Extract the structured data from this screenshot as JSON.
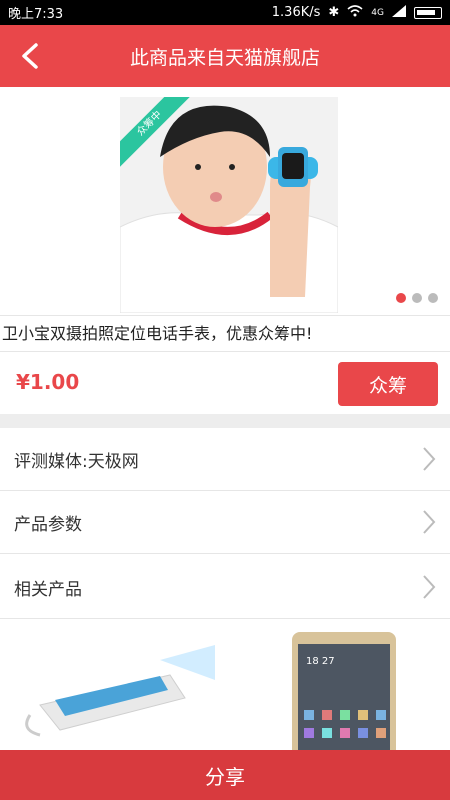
{
  "status_bar": {
    "time": "晚上7:33",
    "speed": "1.36K/s",
    "network": "4G"
  },
  "header": {
    "title": "此商品来自天猫旗舰店",
    "back_icon": "back-arrow-icon"
  },
  "banner": {
    "ribbon_text": "众筹中",
    "carousel_pages": 3,
    "active_page": 1
  },
  "product": {
    "title": "卫小宝双摄拍照定位电话手表，优惠众筹中!",
    "price": "¥1.00",
    "action_label": "众筹"
  },
  "list_items": [
    {
      "label": "评测媒体:天极网"
    },
    {
      "label": "产品参数"
    },
    {
      "label": "相关产品"
    }
  ],
  "related_products": {
    "phone_time": "18 27"
  },
  "footer": {
    "share_label": "分享"
  },
  "colors": {
    "accent": "#e9474a",
    "ribbon": "#2bc59f"
  }
}
